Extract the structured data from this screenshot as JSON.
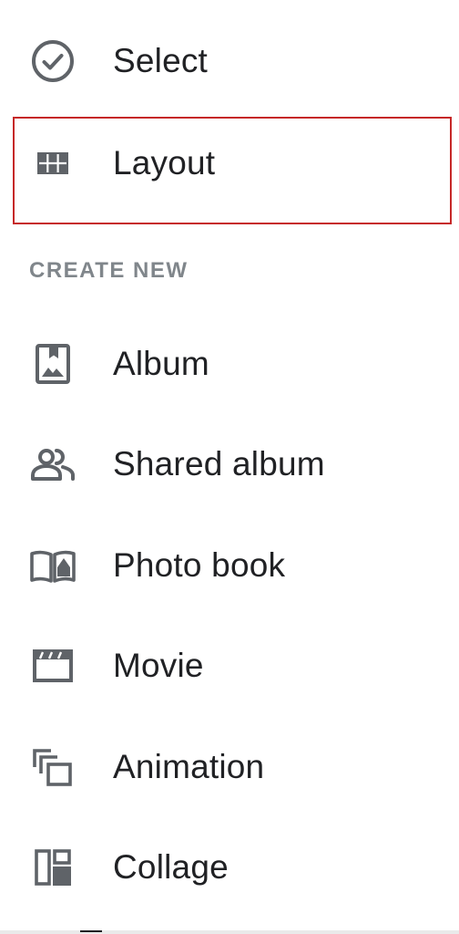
{
  "colors": {
    "icon": "#5f6368",
    "text": "#202124",
    "section_header": "#80868b",
    "highlight_border": "#c62828"
  },
  "top_items": [
    {
      "label": "Select",
      "icon": "check-circle-icon"
    },
    {
      "label": "Layout",
      "icon": "grid-icon"
    }
  ],
  "create_new": {
    "header": "CREATE NEW",
    "items": [
      {
        "label": "Album",
        "icon": "album-icon"
      },
      {
        "label": "Shared album",
        "icon": "people-icon"
      },
      {
        "label": "Photo book",
        "icon": "book-icon"
      },
      {
        "label": "Movie",
        "icon": "movie-icon"
      },
      {
        "label": "Animation",
        "icon": "animation-icon"
      },
      {
        "label": "Collage",
        "icon": "collage-icon"
      }
    ]
  }
}
